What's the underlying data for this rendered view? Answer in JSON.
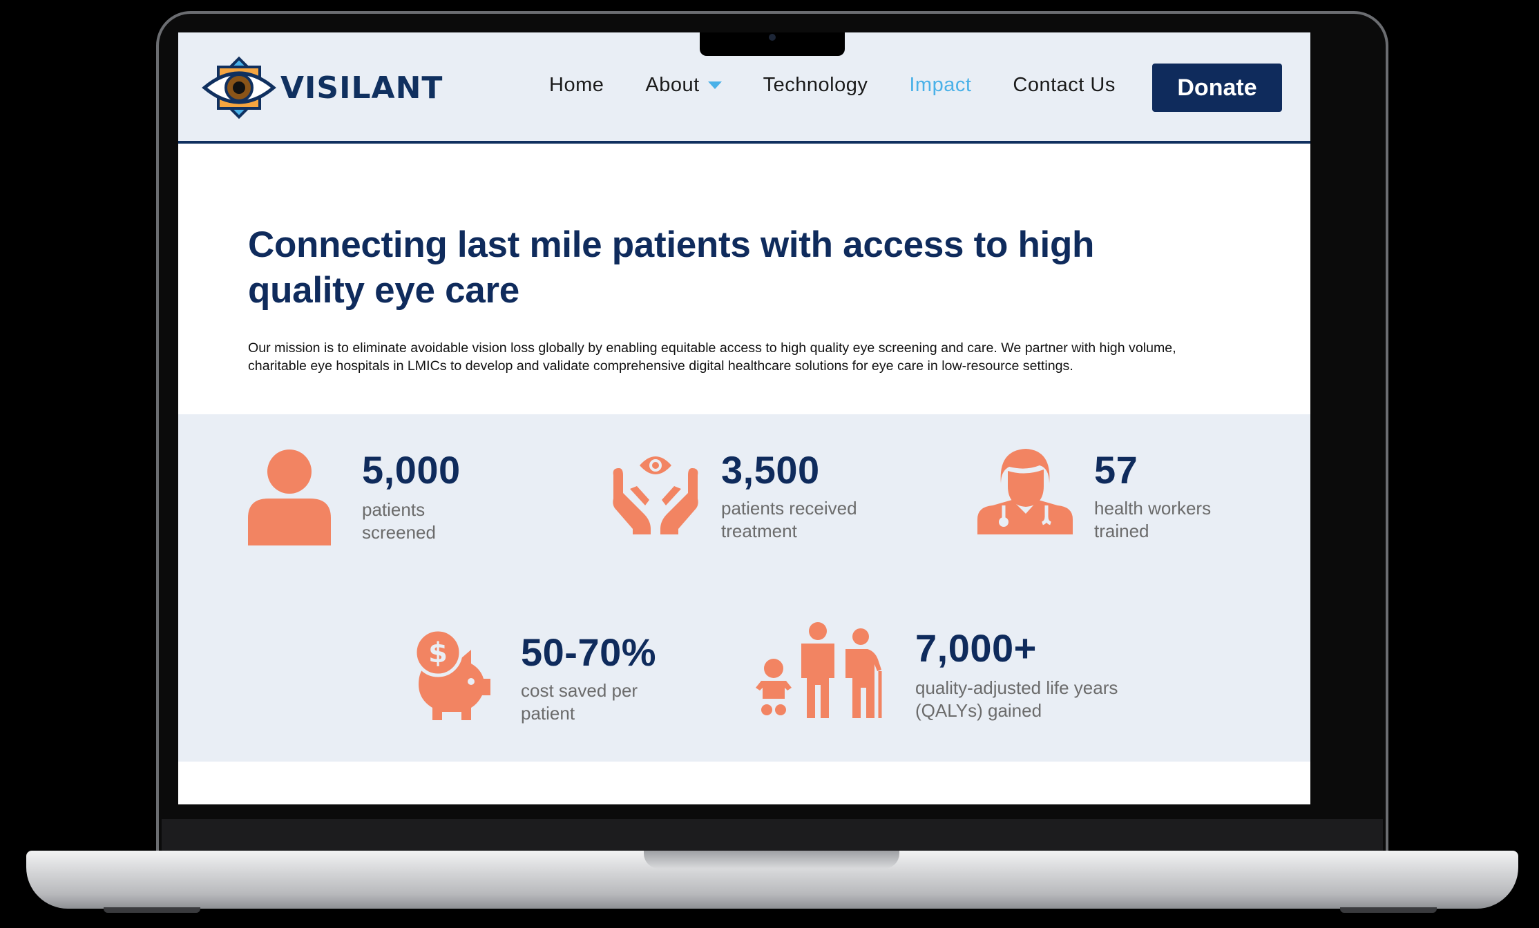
{
  "colors": {
    "navy": "#0f2b5c",
    "accent_orange": "#f28462",
    "nav_active": "#4ab1e8",
    "header_bg": "#e9eef5"
  },
  "header": {
    "logo_text": "VISILANT",
    "nav": [
      {
        "label": "Home",
        "active": false
      },
      {
        "label": "About",
        "active": false,
        "has_dropdown": true
      },
      {
        "label": "Technology",
        "active": false
      },
      {
        "label": "Impact",
        "active": true
      },
      {
        "label": "Contact Us",
        "active": false
      }
    ],
    "donate_label": "Donate"
  },
  "hero": {
    "title": "Connecting last mile patients with access to high quality eye care",
    "mission": "Our mission is to eliminate avoidable vision loss globally by enabling equitable access to high quality eye screening and care. We partner with high volume, charitable eye hospitals in LMICs to develop and validate comprehensive digital healthcare solutions for eye care in low-resource settings."
  },
  "stats": [
    {
      "icon": "person-icon",
      "number": "5,000",
      "label_line1": "patients",
      "label_line2": "screened"
    },
    {
      "icon": "eye-hands-icon",
      "number": "3,500",
      "label_line1": "patients received",
      "label_line2": "treatment"
    },
    {
      "icon": "doctor-icon",
      "number": "57",
      "label_line1": "health workers",
      "label_line2": "trained"
    },
    {
      "icon": "piggy-bank-icon",
      "number": "50-70%",
      "label_line1": "cost saved per",
      "label_line2": "patient"
    },
    {
      "icon": "family-icon",
      "number": "7,000+",
      "label_line1": "quality-adjusted life years",
      "label_line2": "(QALYs) gained"
    }
  ]
}
